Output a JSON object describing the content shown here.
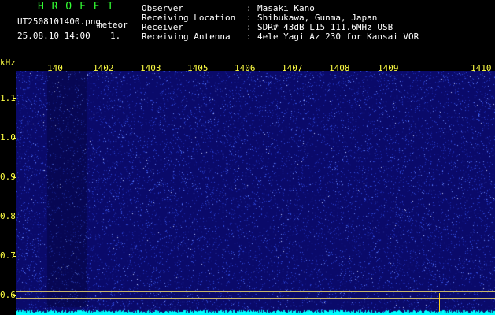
{
  "app": {
    "brand": "H R O F F T",
    "filename": "UT2508101400.png",
    "mode": "meteor",
    "datetime": "25.08.10 14:00",
    "scale": "1."
  },
  "info": {
    "observer_label": "Observer",
    "observer_value": "Masaki Kano",
    "location_label": "Receiving Location",
    "location_value": "Shibukawa, Gunma, Japan",
    "receiver_label": "Receiver",
    "receiver_value": "SDR# 43dB L15 111.6MHz USB",
    "antenna_label": "Receiving Antenna",
    "antenna_value": "4ele Yagi Az 230 for Kansai VOR",
    "sep": ":"
  },
  "axis": {
    "unit": "kHz",
    "y_ticks": [
      "1.1",
      "1.0",
      "0.9",
      "0.8",
      "0.7",
      "0.6"
    ],
    "x_ticks": [
      "140",
      "1402",
      "1403",
      "1405",
      "1406",
      "1407",
      "1408",
      "1409",
      "1410"
    ]
  },
  "colors": {
    "background": "#0a0a6a",
    "noise": "#4a6cff",
    "trace": "#00ffff",
    "guide": "#c8b66a"
  }
}
